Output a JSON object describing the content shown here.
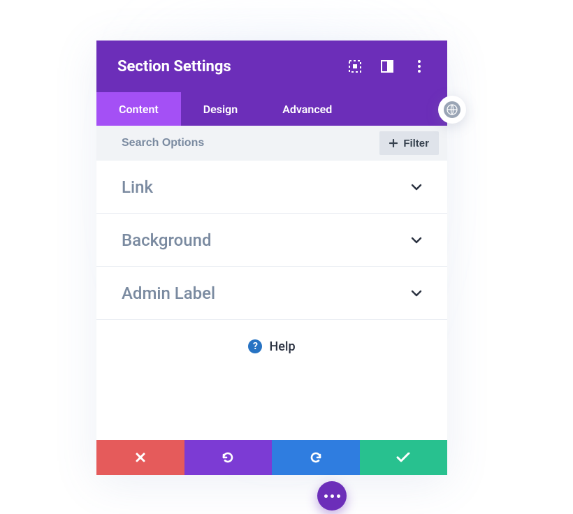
{
  "header": {
    "title": "Section Settings"
  },
  "tabs": [
    {
      "label": "Content",
      "active": true
    },
    {
      "label": "Design",
      "active": false
    },
    {
      "label": "Advanced",
      "active": false
    }
  ],
  "search": {
    "placeholder": "Search Options",
    "filter_label": "Filter"
  },
  "groups": [
    {
      "label": "Link"
    },
    {
      "label": "Background"
    },
    {
      "label": "Admin Label"
    }
  ],
  "help": {
    "label": "Help"
  },
  "colors": {
    "primary": "#6c2eb9",
    "primary_light": "#a450f5",
    "danger": "#e55b5b",
    "info": "#2f7de0",
    "success": "#28c18f"
  }
}
